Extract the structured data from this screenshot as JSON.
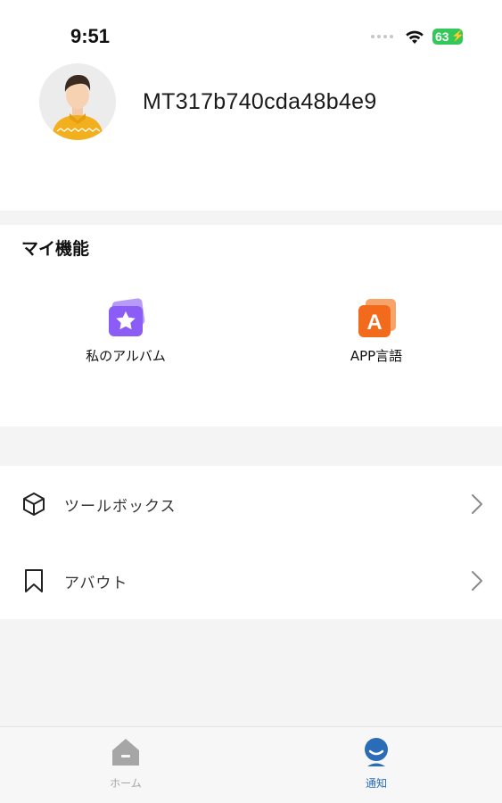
{
  "status_bar": {
    "time": "9:51",
    "battery_level": "63",
    "battery_charging": true
  },
  "profile": {
    "username": "MT317b740cda48b4e9",
    "avatar_icon": "user-avatar-icon"
  },
  "my_functions": {
    "title": "マイ機能",
    "items": [
      {
        "label": "私のアルバム",
        "icon": "album-star-icon",
        "color": "#8b5cf6"
      },
      {
        "label": "APP言語",
        "icon": "language-a-icon",
        "color": "#f26b1d"
      }
    ]
  },
  "menu": [
    {
      "label": "ツールボックス",
      "icon": "box-icon"
    },
    {
      "label": "アバウト",
      "icon": "bookmark-icon"
    }
  ],
  "tabbar": {
    "tabs": [
      {
        "label": "ホーム",
        "icon": "home-icon",
        "active": false
      },
      {
        "label": "通知",
        "icon": "user-circle-icon",
        "active": true
      }
    ],
    "active_color": "#2b6cb8",
    "inactive_color": "#a6a6a6"
  }
}
